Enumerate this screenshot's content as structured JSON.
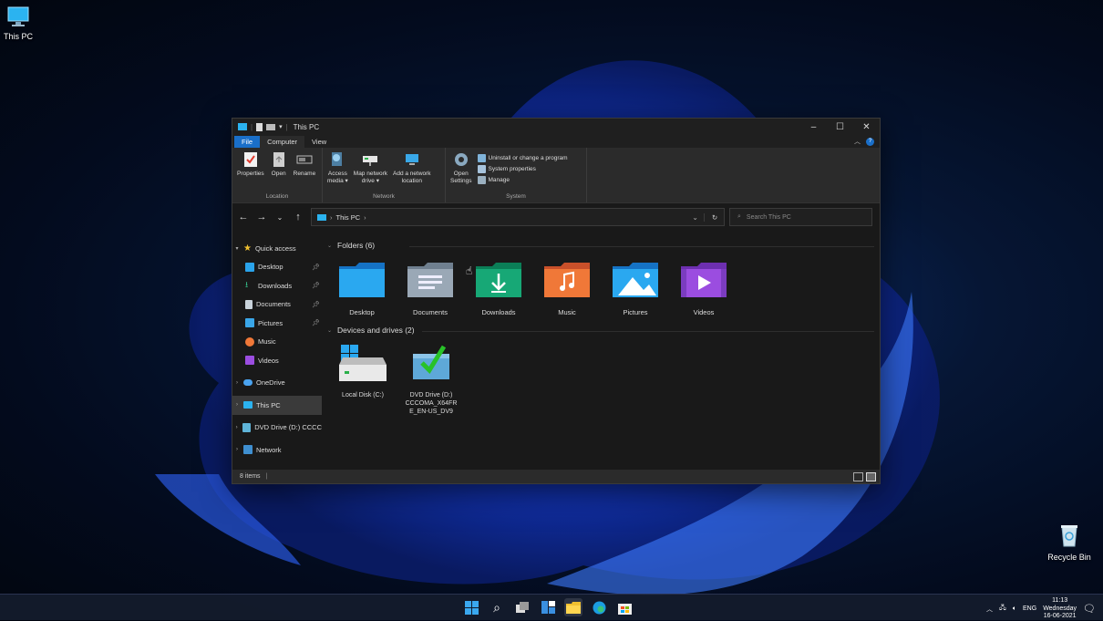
{
  "desktop": {
    "this_pc_label": "This PC",
    "recycle_bin_label": "Recycle Bin"
  },
  "window": {
    "title": "This PC",
    "tabs": {
      "file": "File",
      "computer": "Computer",
      "view": "View"
    },
    "ribbon": {
      "location": {
        "name": "Location",
        "properties": "Properties",
        "open": "Open",
        "rename": "Rename"
      },
      "network": {
        "name": "Network",
        "access_media_1": "Access",
        "access_media_2": "media ▾",
        "map_drive_1": "Map network",
        "map_drive_2": "drive ▾",
        "add_location_1": "Add a network",
        "add_location_2": "location"
      },
      "system": {
        "name": "System",
        "open_settings_1": "Open",
        "open_settings_2": "Settings",
        "uninstall": "Uninstall or change a program",
        "system_properties": "System properties",
        "manage": "Manage"
      }
    },
    "address": {
      "crumb": "This PC",
      "sep": "›"
    },
    "search": {
      "placeholder": "Search This PC"
    },
    "nav_pane": {
      "quick_access": "Quick access",
      "desktop": "Desktop",
      "downloads": "Downloads",
      "documents": "Documents",
      "pictures": "Pictures",
      "music": "Music",
      "videos": "Videos",
      "onedrive": "OneDrive",
      "this_pc": "This PC",
      "dvd_drive": "DVD Drive (D:) CCCC",
      "network": "Network"
    },
    "folders_header": "Folders (6)",
    "folders": [
      "Desktop",
      "Documents",
      "Downloads",
      "Music",
      "Pictures",
      "Videos"
    ],
    "devices_header": "Devices and drives (2)",
    "drives": {
      "local_disk": "Local Disk (C:)",
      "dvd_line1": "DVD Drive (D:)",
      "dvd_line2": "CCCOMA_X64FR",
      "dvd_line3": "E_EN-US_DV9"
    },
    "status": {
      "items": "8 items"
    }
  },
  "taskbar": {
    "lang": "ENG",
    "time": "11:13",
    "day": "Wednesday",
    "date": "16-06-2021"
  },
  "colors": {
    "accent": "#1a6fc9",
    "folder_blue": "#1e9bea",
    "folder_green": "#17a876",
    "folder_orange": "#f07838",
    "folder_purple": "#9b4de0"
  }
}
